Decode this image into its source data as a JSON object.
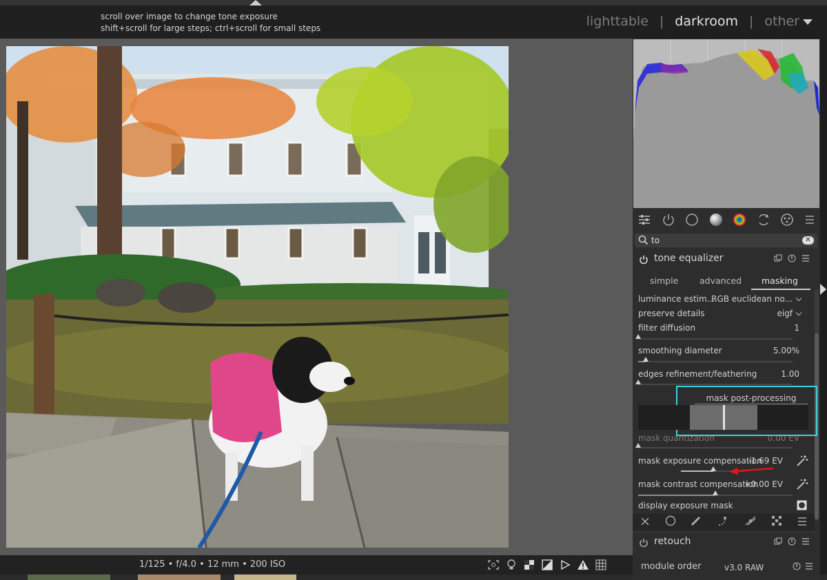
{
  "hints": {
    "line1": "scroll over image to change tone exposure",
    "line2": "shift+scroll for large steps; ctrl+scroll for small steps"
  },
  "views": {
    "lighttable": "lighttable",
    "darkroom": "darkroom",
    "other": "other",
    "separator": "|"
  },
  "exif": "1/125 • f/4.0 • 12 mm • 200 ISO",
  "search": {
    "value": "to",
    "clear": "✕"
  },
  "tone_equalizer": {
    "name": "tone equalizer",
    "tabs": [
      "simple",
      "advanced",
      "masking"
    ],
    "params": {
      "luminance_estimator": {
        "label": "luminance estim...",
        "value": "RGB euclidean no..."
      },
      "preserve_details": {
        "label": "preserve details",
        "value": "eigf"
      },
      "filter_diffusion": {
        "label": "filter diffusion",
        "value": "1",
        "level": 0.0
      },
      "smoothing_diameter": {
        "label": "smoothing diameter",
        "value": "5.00%",
        "level": 0.05
      },
      "edges_refinement": {
        "label": "edges refinement/feathering",
        "value": "1.00",
        "level": 0.0
      },
      "mask_post_processing": {
        "label": "mask post-processing"
      },
      "mask_quantization": {
        "label": "mask quantization",
        "value": "0.00 EV",
        "level": 0.0
      },
      "mask_exposure_compensation": {
        "label": "mask exposure compensation",
        "value": "-1.69 EV",
        "level": 0.5
      },
      "mask_contrast_compensation": {
        "label": "mask contrast compensation",
        "value": "+0.00 EV",
        "level": 0.5
      },
      "display_exposure_mask": {
        "label": "display exposure mask"
      }
    }
  },
  "retouch": {
    "name": "retouch"
  },
  "module_order": {
    "label": "module order",
    "value": "v3.0 RAW"
  },
  "colors": {
    "highlight": "#3dd2e0",
    "annotation_arrow": "#e01818"
  }
}
